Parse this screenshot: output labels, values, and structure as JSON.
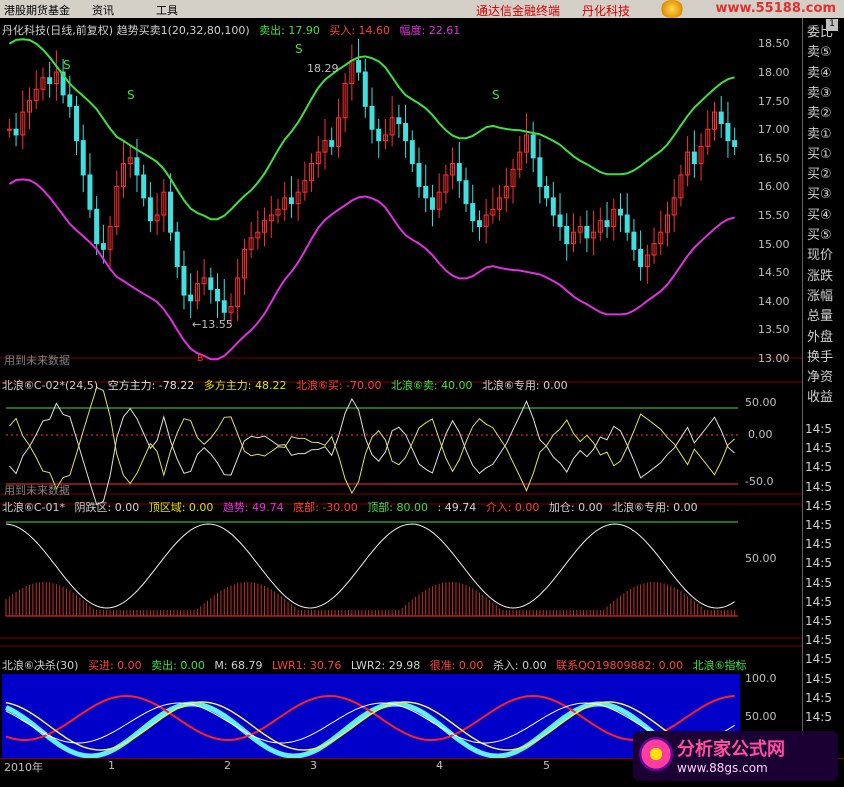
{
  "menu": {
    "items": [
      "港股期货基金",
      "资讯",
      "工具"
    ],
    "brand1": "通达信金融终端",
    "brand2": "丹化科技",
    "site": "www.55188.com"
  },
  "panel1": {
    "title": "丹化科技(日线,前复权) 趋势买卖1(20,32,80,100)",
    "sell_label": "卖出: 17.90",
    "buy_label": "买入: 14.60",
    "range_label": "幅度: 22.61",
    "future_note": "用到未来数据",
    "high_marker": "18.29",
    "low_marker": "←13.55",
    "s_marks": [
      "S",
      "S",
      "S",
      "S"
    ],
    "b_mark": "B",
    "price_ticks": [
      "18.50",
      "18.00",
      "17.50",
      "17.00",
      "16.50",
      "16.00",
      "15.50",
      "15.00",
      "14.50",
      "14.00",
      "13.50",
      "13.00"
    ]
  },
  "panel2": {
    "name": "北浪⑥C-02*(24,5)",
    "f1": "空方主力: -78.22",
    "f2": "多方主力: 48.22",
    "f3": "北浪⑥买: -70.00",
    "f4": "北浪⑥卖: 40.00",
    "f5": "北浪⑥专用: 0.00",
    "future_note": "用到未来数据",
    "ticks": [
      "50.00",
      "0.00",
      "-50.0"
    ]
  },
  "panel3": {
    "name": "北浪⑥C-01*",
    "f1": "阴跌区: 0.00",
    "f2": "顶区域: 0.00",
    "f3": "趋势: 49.74",
    "f4": "底部: -30.00",
    "f5": "顶部: 80.00",
    "f6": ": 49.74",
    "f7": "介入: 0.00",
    "f8": "加仓: 0.00",
    "f9": "北浪⑥专用: 0.00",
    "ticks": [
      "50.00"
    ]
  },
  "panel4": {
    "name": "北浪⑥决杀(30)",
    "f1": "买进: 0.00",
    "f2": "卖出: 0.00",
    "f3": "M: 68.79",
    "f4": "LWR1: 30.76",
    "f5": "LWR2: 29.98",
    "f6": "很准: 0.00",
    "f7": "杀入: 0.00",
    "f8": "联系QQ19809882: 0.00",
    "f9": "北浪⑥指标",
    "ticks": [
      "100.0",
      "50.00"
    ]
  },
  "sidebar": {
    "labels": [
      "委比",
      "卖⑤",
      "卖④",
      "卖③",
      "卖②",
      "卖①",
      "买①",
      "买②",
      "买③",
      "买④",
      "买⑤",
      "现价",
      "涨跌",
      "涨幅",
      "总量",
      "外盘",
      "换手",
      "净资",
      "收益"
    ],
    "times": [
      "14:5",
      "14:5",
      "14:5",
      "14:5",
      "14:5",
      "14:5",
      "14:5",
      "14:5",
      "14:5",
      "14:5",
      "14:5",
      "14:5",
      "14:5",
      "14:5",
      "14:5",
      "14:5",
      "14:5"
    ],
    "top_button": "1"
  },
  "timeaxis": {
    "labels": [
      "2010年",
      "1",
      "2",
      "3",
      "4",
      "5"
    ]
  },
  "watermark": {
    "title": "分析家公式网",
    "url": "www.88gs.com"
  },
  "colors": {
    "up": "#ff3030",
    "down": "#40e0e0",
    "upper_band": "#40e040",
    "lower_band": "#e030e0"
  },
  "chart_data": {
    "type": "candlestick",
    "title": "丹化科技(日线,前复权) 趋势买卖1(20,32,80,100)",
    "ylim": [
      13.0,
      18.7
    ],
    "series": [
      {
        "name": "price",
        "values": [
          17.0,
          16.9,
          17.3,
          17.5,
          17.7,
          17.9,
          17.8,
          18.0,
          17.6,
          17.4,
          16.8,
          16.2,
          15.6,
          15.0,
          14.9,
          15.3,
          16.0,
          16.4,
          16.5,
          16.2,
          15.8,
          15.4,
          15.5,
          15.9,
          15.2,
          14.6,
          14.1,
          14.0,
          14.3,
          14.4,
          14.2,
          14.0,
          13.8,
          13.9,
          14.4,
          14.9,
          15.1,
          15.2,
          15.4,
          15.5,
          15.6,
          15.8,
          15.7,
          15.9,
          16.1,
          16.4,
          16.6,
          16.8,
          16.7,
          17.2,
          17.8,
          18.2,
          18.0,
          17.4,
          17.0,
          16.8,
          16.9,
          17.2,
          17.1,
          16.8,
          16.4,
          16.0,
          15.8,
          15.6,
          15.9,
          16.2,
          16.4,
          16.1,
          15.7,
          15.4,
          15.3,
          15.5,
          15.6,
          15.8,
          16.0,
          16.3,
          16.6,
          16.9,
          16.5,
          16.0,
          15.8,
          15.5,
          15.3,
          15.0,
          15.2,
          15.3,
          15.1,
          15.2,
          15.4,
          15.3,
          15.6,
          15.5,
          15.2,
          14.9,
          14.6,
          14.8,
          15.0,
          15.2,
          15.5,
          15.8,
          16.2,
          16.6,
          16.4,
          16.7,
          17.0,
          17.3,
          17.1,
          16.8,
          16.7
        ]
      }
    ],
    "annotations": [
      "18.29",
      "←13.55"
    ]
  }
}
